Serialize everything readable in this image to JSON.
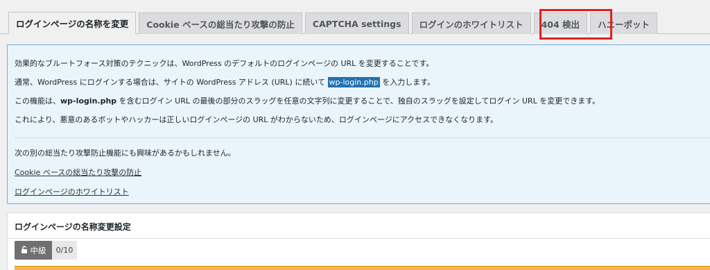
{
  "tabs": [
    {
      "label": "ログインページの名称を変更"
    },
    {
      "label": "Cookie ベースの総当たり攻撃の防止"
    },
    {
      "label": "CAPTCHA settings"
    },
    {
      "label": "ログインのホワイトリスト"
    },
    {
      "label": "404 検出"
    },
    {
      "label": "ハニーポット"
    }
  ],
  "info": {
    "line1": "効果的なブルートフォース対策のテクニックは、WordPress のデフォルトのログインページの URL を変更することです。",
    "line2_before": "通常、WordPress にログインする場合は、サイトの WordPress アドレス (URL) に続いて ",
    "line2_code": "wp-login.php",
    "line2_after": " を入力します。",
    "line3_before": "この機能は、",
    "line3_code": "wp-login.php",
    "line3_after": " を含むログイン URL の最後の部分のスラッグを任意の文字列に変更することで、独自のスラッグを設定してログイン URL を変更できます。",
    "line4": "これにより、悪意のあるボットやハッカーは正しいログインページの URL がわからないため、ログインページにアクセスできなくなります。",
    "related_intro": "次の別の総当たり攻撃防止機能にも興味があるかもしれません。",
    "link1": "Cookie ベースの総当たり攻撃の防止",
    "link2": "ログインページのホワイトリスト"
  },
  "panel": {
    "title": "ログインページの名称変更設定",
    "level": "中級",
    "score": "0/10",
    "level_icon": "lock-icon"
  }
}
